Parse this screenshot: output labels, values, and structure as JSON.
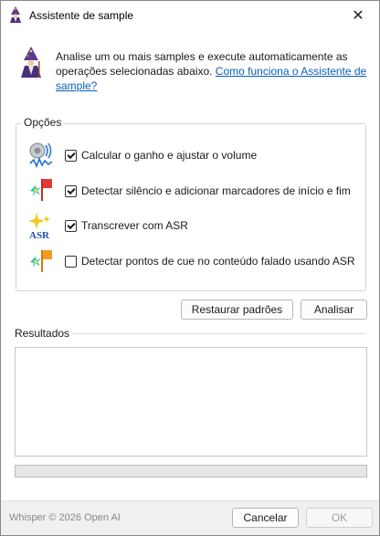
{
  "window": {
    "title": "Assistente de sample",
    "app_icon": "wizard-icon",
    "close_glyph": "✕"
  },
  "intro": {
    "icon": "wizard-icon",
    "text": "Analise um ou mais samples e execute automaticamente as operações selecionadas abaixo. ",
    "link_text": "Como funciona o Assistente de sample?"
  },
  "options": {
    "group_label": "Opções",
    "items": [
      {
        "icon": "audio-gain-icon",
        "label": "Calcular o ganho e ajustar o volume",
        "checked": true
      },
      {
        "icon": "silence-markers-icon",
        "label": "Detectar silêncio e adicionar marcadores de início e fim",
        "checked": true
      },
      {
        "icon": "asr-icon",
        "label": "Transcrever com ASR",
        "checked": true
      },
      {
        "icon": "cue-points-icon",
        "label": "Detectar pontos de cue no conteúdo falado usando ASR",
        "checked": false
      }
    ]
  },
  "buttons": {
    "restore_defaults": "Restaurar padrões",
    "analyze": "Analisar",
    "cancel": "Cancelar",
    "ok": "OK"
  },
  "results": {
    "label": "Resultados",
    "progress": 0
  },
  "footer": {
    "text": "Whisper © 2026 Open AI"
  },
  "colors": {
    "link": "#0a5fc0",
    "progress_fill": "#06b025"
  }
}
